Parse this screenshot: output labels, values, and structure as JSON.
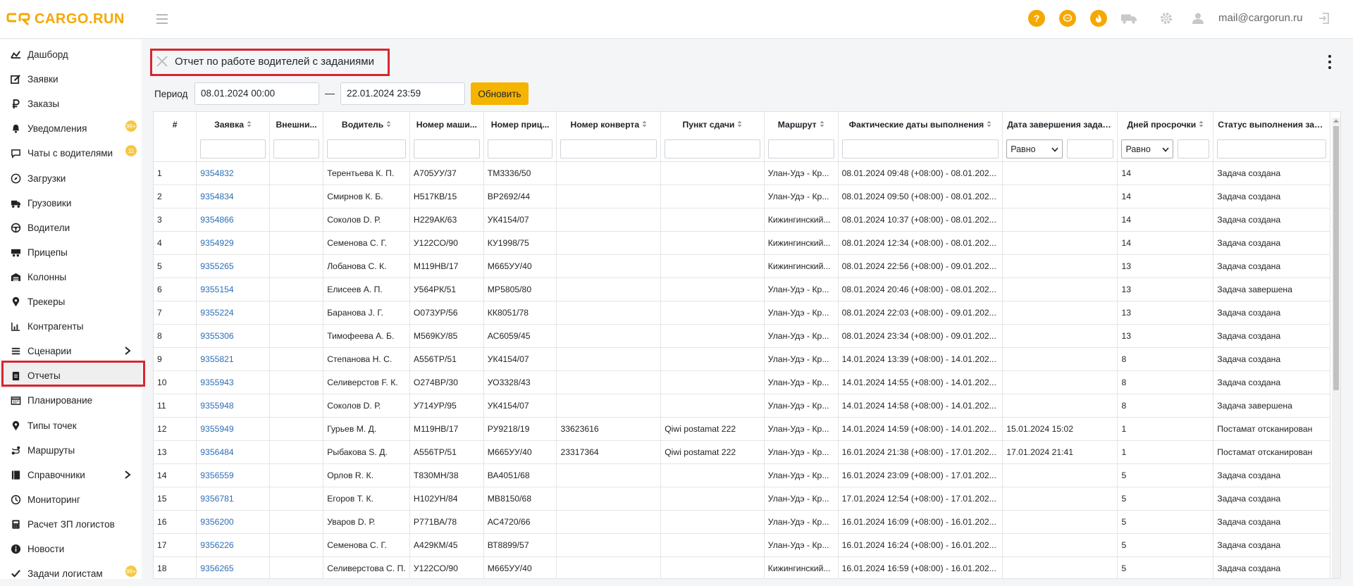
{
  "app": {
    "logo_text": "CARGO.RUN",
    "brand_color": "#f5a800",
    "user_email": "mail@cargorun.ru"
  },
  "header_icons": [
    "help-icon",
    "chat-icon",
    "fire-icon",
    "truck-icon",
    "gear-icon",
    "user-icon",
    "logout-icon"
  ],
  "sidebar": {
    "items": [
      {
        "label": "Дашборд",
        "icon": "dashboard-icon"
      },
      {
        "label": "Заявки",
        "icon": "edit-icon"
      },
      {
        "label": "Заказы",
        "icon": "ruble-icon"
      },
      {
        "label": "Уведомления",
        "icon": "bell-icon",
        "badge": "99+"
      },
      {
        "label": "Чаты с водителями",
        "icon": "chat-bubble-icon",
        "badge": "11"
      },
      {
        "label": "Загрузки",
        "icon": "compass-icon"
      },
      {
        "label": "Грузовики",
        "icon": "truck-icon"
      },
      {
        "label": "Водители",
        "icon": "steering-wheel-icon"
      },
      {
        "label": "Прицепы",
        "icon": "trailer-icon"
      },
      {
        "label": "Колонны",
        "icon": "warehouse-icon"
      },
      {
        "label": "Трекеры",
        "icon": "map-pin-icon"
      },
      {
        "label": "Контрагенты",
        "icon": "chart-icon"
      },
      {
        "label": "Сценарии",
        "icon": "list-icon",
        "chevron": true
      },
      {
        "label": "Отчеты",
        "icon": "clipboard-icon",
        "active": true
      },
      {
        "label": "Планирование",
        "icon": "calendar-icon"
      },
      {
        "label": "Типы точек",
        "icon": "map-pin-icon"
      },
      {
        "label": "Маршруты",
        "icon": "route-icon"
      },
      {
        "label": "Справочники",
        "icon": "book-icon",
        "chevron": true
      },
      {
        "label": "Мониторинг",
        "icon": "monitor-icon"
      },
      {
        "label": "Расчет ЗП логистов",
        "icon": "calculator-icon"
      },
      {
        "label": "Новости",
        "icon": "info-icon"
      },
      {
        "label": "Задачи логистам",
        "icon": "check-icon",
        "badge": "99+"
      }
    ]
  },
  "page": {
    "title": "Отчет по работе водителей с заданиями",
    "period_label": "Период",
    "date_from": "08.01.2024 00:00",
    "date_sep": "—",
    "date_to": "22.01.2024 23:59",
    "refresh_label": "Обновить"
  },
  "table": {
    "columns": [
      "#",
      "Заявка",
      "Внешни...",
      "Водитель",
      "Номер маши...",
      "Номер приц...",
      "Номер конверта",
      "Пункт сдачи",
      "Маршрут",
      "Фактические даты выполнения",
      "Дата завершения задан...",
      "Дней просрочки",
      "Статус выполнения зад..."
    ],
    "filter_select": "Равно",
    "rows": [
      [
        "1",
        "9354832",
        "",
        "Терентьева К. П.",
        "А705УУ/37",
        "ТМ3336/50",
        "",
        "",
        "Улан-Удэ - Кр...",
        "08.01.2024 09:48 (+08:00) - 08.01.202...",
        "",
        "14",
        "Задача создана"
      ],
      [
        "2",
        "9354834",
        "",
        "Смирнов К. Б.",
        "Н517КВ/15",
        "ВР2692/44",
        "",
        "",
        "Улан-Удэ - Кр...",
        "08.01.2024 09:50 (+08:00) - 08.01.202...",
        "",
        "14",
        "Задача создана"
      ],
      [
        "3",
        "9354866",
        "",
        "Соколов D. Р.",
        "Н229АК/63",
        "УК4154/07",
        "",
        "",
        "Кижингинский...",
        "08.01.2024 10:37 (+08:00) - 08.01.202...",
        "",
        "14",
        "Задача создана"
      ],
      [
        "4",
        "9354929",
        "",
        "Семенова С. Г.",
        "У122СО/90",
        "КУ1998/75",
        "",
        "",
        "Кижингинский...",
        "08.01.2024 12:34 (+08:00) - 08.01.202...",
        "",
        "14",
        "Задача создана"
      ],
      [
        "5",
        "9355265",
        "",
        "Лобанова С. К.",
        "М119НВ/17",
        "М665УУ/40",
        "",
        "",
        "Кижингинский...",
        "08.01.2024 22:56 (+08:00) - 09.01.202...",
        "",
        "13",
        "Задача создана"
      ],
      [
        "6",
        "9355154",
        "",
        "Елисеев А. П.",
        "У564РК/51",
        "МР5805/80",
        "",
        "",
        "Улан-Удэ - Кр...",
        "08.01.2024 20:46 (+08:00) - 08.01.202...",
        "",
        "13",
        "Задача завершена"
      ],
      [
        "7",
        "9355224",
        "",
        "Баранова J. Г.",
        "О073УР/56",
        "КК8051/78",
        "",
        "",
        "Улан-Удэ - Кр...",
        "08.01.2024 22:03 (+08:00) - 09.01.202...",
        "",
        "13",
        "Задача создана"
      ],
      [
        "8",
        "9355306",
        "",
        "Тимофеева А. Б.",
        "М569КУ/85",
        "АС6059/45",
        "",
        "",
        "Улан-Удэ - Кр...",
        "08.01.2024 23:34 (+08:00) - 09.01.202...",
        "",
        "13",
        "Задача создана"
      ],
      [
        "9",
        "9355821",
        "",
        "Степанова Н. С.",
        "А556ТР/51",
        "УК4154/07",
        "",
        "",
        "Улан-Удэ - Кр...",
        "14.01.2024 13:39 (+08:00) - 14.01.202...",
        "",
        "8",
        "Задача создана"
      ],
      [
        "10",
        "9355943",
        "",
        "Селиверстов F. К.",
        "О274ВР/30",
        "УО3328/43",
        "",
        "",
        "Улан-Удэ - Кр...",
        "14.01.2024 14:55 (+08:00) - 14.01.202...",
        "",
        "8",
        "Задача создана"
      ],
      [
        "11",
        "9355948",
        "",
        "Соколов D. Р.",
        "У714УР/95",
        "УК4154/07",
        "",
        "",
        "Улан-Удэ - Кр...",
        "14.01.2024 14:58 (+08:00) - 14.01.202...",
        "",
        "8",
        "Задача завершена"
      ],
      [
        "12",
        "9355949",
        "",
        "Гурьев М. Д.",
        "М119НВ/17",
        "РУ9218/19",
        "33623616",
        "Qiwi postamat 222",
        "Улан-Удэ - Кр...",
        "14.01.2024 14:59 (+08:00) - 14.01.202...",
        "15.01.2024 15:02",
        "1",
        "Постамат отсканирован"
      ],
      [
        "13",
        "9356484",
        "",
        "Рыбакова S. Д.",
        "А556ТР/51",
        "М665УУ/40",
        "23317364",
        "Qiwi postamat 222",
        "Улан-Удэ - Кр...",
        "16.01.2024 21:38 (+08:00) - 17.01.202...",
        "17.01.2024 21:41",
        "1",
        "Постамат отсканирован"
      ],
      [
        "14",
        "9356559",
        "",
        "Орлов R. К.",
        "Т830МН/38",
        "ВА4051/68",
        "",
        "",
        "Улан-Удэ - Кр...",
        "16.01.2024 23:09 (+08:00) - 17.01.202...",
        "",
        "5",
        "Задача создана"
      ],
      [
        "15",
        "9356781",
        "",
        "Егоров Т. К.",
        "Н102УН/84",
        "МВ8150/68",
        "",
        "",
        "Улан-Удэ - Кр...",
        "17.01.2024 12:54 (+08:00) - 17.01.202...",
        "",
        "5",
        "Задача создана"
      ],
      [
        "16",
        "9356200",
        "",
        "Уваров D. Р.",
        "Р771ВА/78",
        "АС4720/66",
        "",
        "",
        "Улан-Удэ - Кр...",
        "16.01.2024 16:09 (+08:00) - 16.01.202...",
        "",
        "5",
        "Задача создана"
      ],
      [
        "17",
        "9356226",
        "",
        "Семенова С. Г.",
        "А429КМ/45",
        "ВТ8899/57",
        "",
        "",
        "Улан-Удэ - Кр...",
        "16.01.2024 16:24 (+08:00) - 16.01.202...",
        "",
        "5",
        "Задача создана"
      ],
      [
        "18",
        "9356265",
        "",
        "Селиверстова С. П.",
        "У122СО/90",
        "М665УУ/40",
        "",
        "",
        "Кижингинский...",
        "16.01.2024 16:59 (+08:00) - 16.01.202...",
        "",
        "5",
        "Задача создана"
      ]
    ]
  }
}
